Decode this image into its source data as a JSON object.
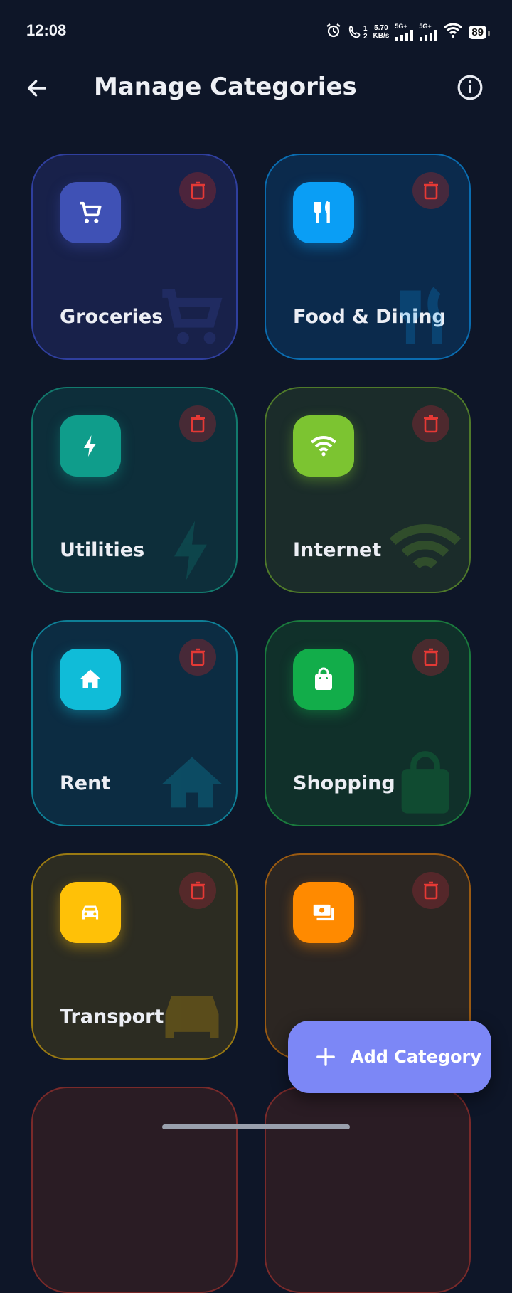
{
  "status_bar": {
    "time": "12:08",
    "sim1": "1",
    "sim2": "2",
    "rate_value": "5.70",
    "rate_unit": "KB/s",
    "net1": "5G+",
    "net2": "5G+",
    "battery": "89"
  },
  "app_bar": {
    "title": "Manage Categories"
  },
  "categories": [
    {
      "label": "Groceries",
      "icon": "cart-icon",
      "color": "#3f51b5",
      "border": "#2f3f9e",
      "bg": "#18214a"
    },
    {
      "label": "Food & Dining",
      "icon": "utensils-icon",
      "color": "#0a9ef5",
      "border": "#0a6cb0",
      "bg": "#0b2a4c"
    },
    {
      "label": "Utilities",
      "icon": "bolt-icon",
      "color": "#0f9d8b",
      "border": "#127a6d",
      "bg": "#0d2e3a"
    },
    {
      "label": "Internet",
      "icon": "wifi-icon",
      "color": "#7cc431",
      "border": "#4f7a2a",
      "bg": "#1b2c2a"
    },
    {
      "label": "Rent",
      "icon": "home-icon",
      "color": "#10bcd8",
      "border": "#0e7f96",
      "bg": "#0c2c42"
    },
    {
      "label": "Shopping",
      "icon": "bag-icon",
      "color": "#12ad4a",
      "border": "#1a7a3d",
      "bg": "#10302a"
    },
    {
      "label": "Transport",
      "icon": "car-icon",
      "color": "#ffc107",
      "border": "#9a7a12",
      "bg": "#2c2c22"
    },
    {
      "label": "",
      "icon": "cash-icon",
      "color": "#ff8a00",
      "border": "#9a5a12",
      "bg": "#2c2622"
    }
  ],
  "fab": {
    "label": "Add Category"
  }
}
